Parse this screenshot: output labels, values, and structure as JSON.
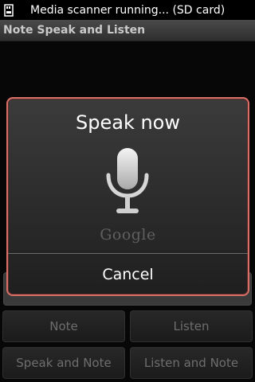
{
  "status_bar": {
    "icon": "sd-card-scan-icon",
    "text": "Media scanner running... (SD card)"
  },
  "app": {
    "title": "Note Speak and Listen"
  },
  "buttons": {
    "note": "Note",
    "listen": "Listen",
    "speak_and_note": "Speak and Note",
    "listen_and_note": "Listen and Note"
  },
  "dialog": {
    "title": "Speak now",
    "mic_icon": "microphone-icon",
    "brand": "Google",
    "cancel": "Cancel",
    "border_color": "#d97068"
  }
}
